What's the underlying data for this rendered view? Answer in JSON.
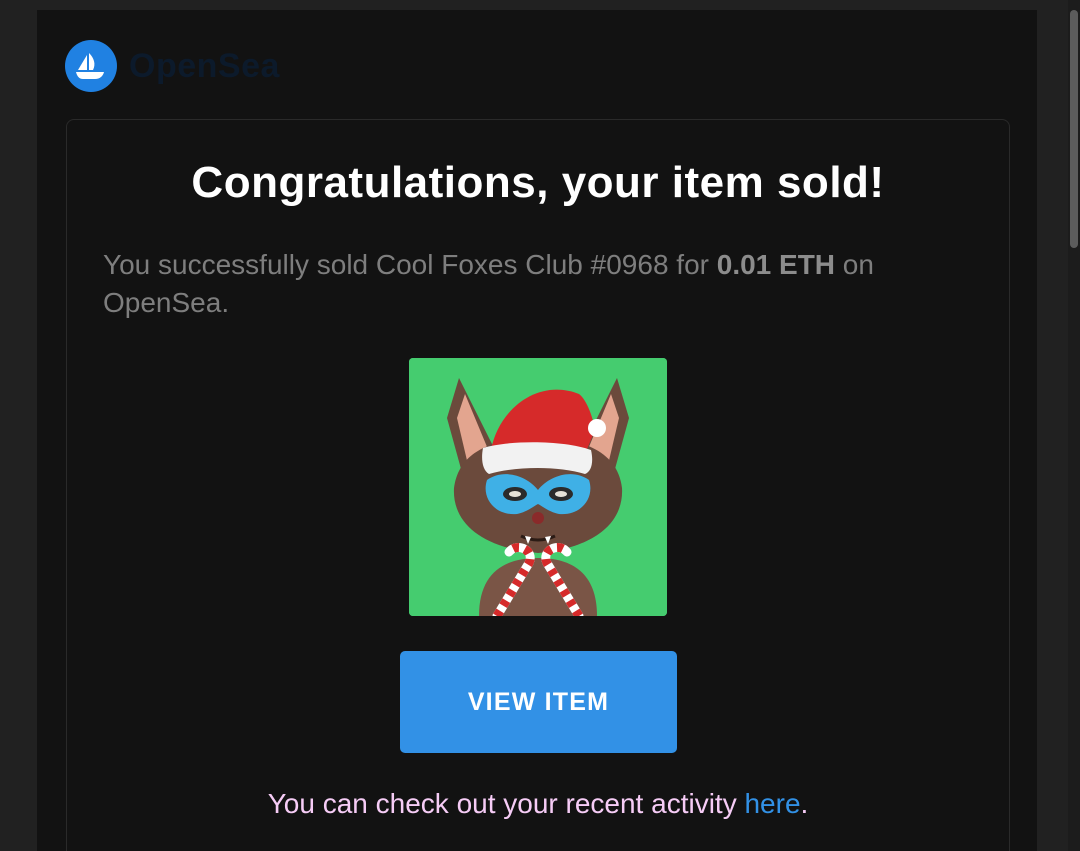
{
  "brand": {
    "name": "OpenSea",
    "accent_color": "#2081E2"
  },
  "email": {
    "heading": "Congratulations, your item sold!",
    "summary_prefix": "You successfully sold Cool Foxes Club #0968 for ",
    "summary_price": "0.01 ETH",
    "summary_suffix": " on OpenSea.",
    "item_image_alt": "Cool Foxes Club #0968",
    "button_label": "VIEW ITEM",
    "activity_prefix": "You can check out your recent activity ",
    "activity_link": "here",
    "activity_suffix": "."
  },
  "icons": {
    "logo": "opensea-ship-icon"
  }
}
